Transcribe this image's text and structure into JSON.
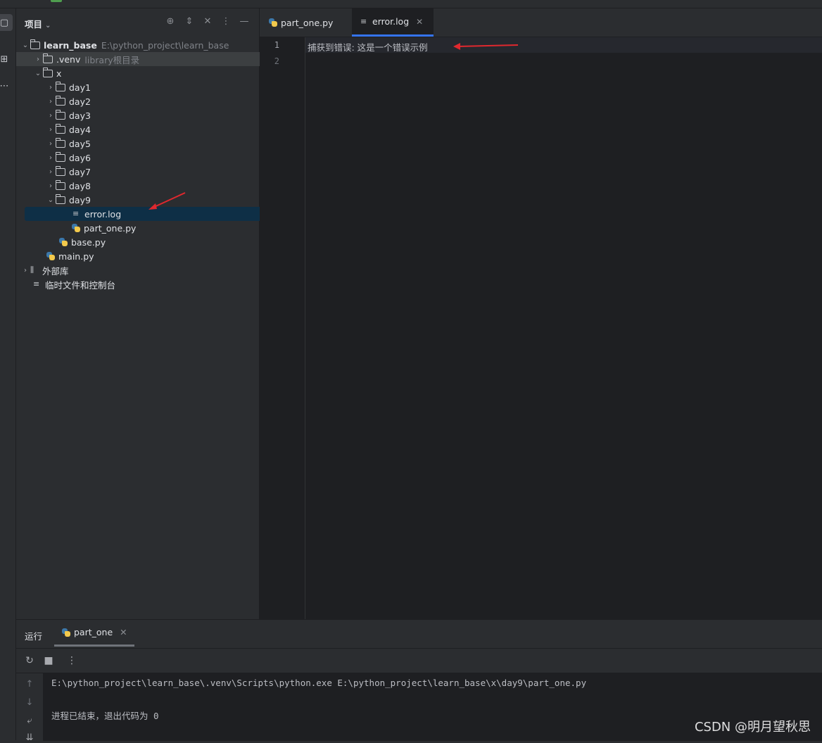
{
  "project_panel": {
    "title": "项目",
    "tree": [
      {
        "label": "learn_base",
        "note": "E:\\python_project\\learn_base"
      },
      {
        "label": ".venv",
        "note": "library根目录"
      },
      {
        "label": "x"
      },
      {
        "label": "day1"
      },
      {
        "label": "day2"
      },
      {
        "label": "day3"
      },
      {
        "label": "day4"
      },
      {
        "label": "day5"
      },
      {
        "label": "day6"
      },
      {
        "label": "day7"
      },
      {
        "label": "day8"
      },
      {
        "label": "day9"
      },
      {
        "label": "error.log"
      },
      {
        "label": "part_one.py"
      },
      {
        "label": "base.py"
      },
      {
        "label": "main.py"
      },
      {
        "label": "外部库"
      },
      {
        "label": "临时文件和控制台"
      }
    ]
  },
  "editor": {
    "tabs": [
      {
        "label": "part_one.py"
      },
      {
        "label": "error.log"
      }
    ],
    "line_numbers": [
      "1",
      "2"
    ],
    "lines": [
      "捕获到错误: 这是一个错误示例",
      ""
    ]
  },
  "run_panel": {
    "title": "运行",
    "tab_label": "part_one",
    "console": [
      "E:\\python_project\\learn_base\\.venv\\Scripts\\python.exe E:\\python_project\\learn_base\\x\\day9\\part_one.py",
      "",
      "进程已结束，退出代码为 0"
    ]
  },
  "watermark": "CSDN @明月望秋思",
  "colors": {
    "accent": "#3574f0",
    "selection": "#0e2f46",
    "annotation_arrow": "#e0282e"
  }
}
